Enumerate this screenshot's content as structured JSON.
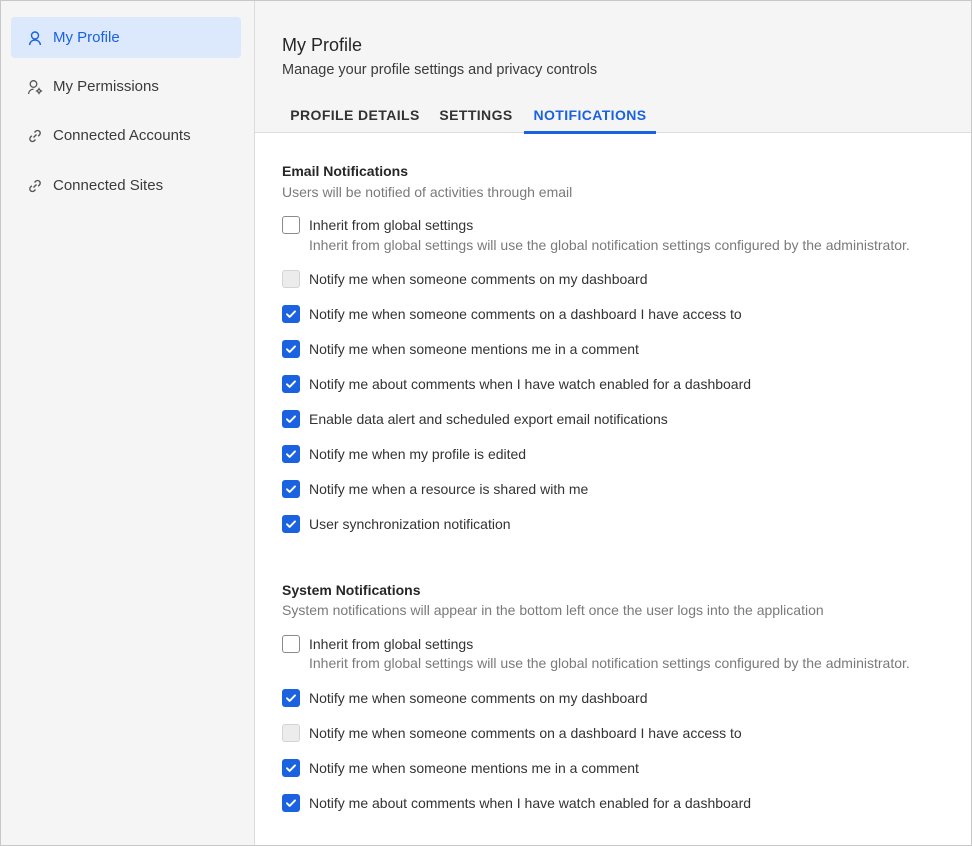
{
  "sidebar": {
    "items": [
      {
        "label": "My Profile",
        "icon": "user-icon",
        "active": true
      },
      {
        "label": "My Permissions",
        "icon": "user-gear-icon",
        "active": false
      },
      {
        "label": "Connected Accounts",
        "icon": "link-icon",
        "active": false
      },
      {
        "label": "Connected Sites",
        "icon": "link-icon",
        "active": false
      }
    ]
  },
  "header": {
    "title": "My Profile",
    "subtitle": "Manage your profile settings and privacy controls",
    "tabs": [
      {
        "label": "PROFILE DETAILS",
        "active": false
      },
      {
        "label": "SETTINGS",
        "active": false
      },
      {
        "label": "NOTIFICATIONS",
        "active": true
      }
    ]
  },
  "colors": {
    "accent": "#1a62e0",
    "active_bg": "#dce8fb"
  },
  "email": {
    "title": "Email Notifications",
    "description": "Users will be notified of activities through email",
    "options": [
      {
        "label": "Inherit from global settings",
        "help": "Inherit from global settings will use the global notification settings configured by the administrator.",
        "state": "unchecked"
      },
      {
        "label": "Notify me when someone comments on my dashboard",
        "state": "disabled"
      },
      {
        "label": "Notify me when someone comments on a dashboard I have access to",
        "state": "checked"
      },
      {
        "label": "Notify me when someone mentions me in a comment",
        "state": "checked"
      },
      {
        "label": "Notify me about comments when I have watch enabled for a dashboard",
        "state": "checked"
      },
      {
        "label": "Enable data alert and scheduled export email notifications",
        "state": "checked"
      },
      {
        "label": "Notify me when my profile is edited",
        "state": "checked"
      },
      {
        "label": "Notify me when a resource is shared with me",
        "state": "checked"
      },
      {
        "label": "User synchronization notification",
        "state": "checked"
      }
    ]
  },
  "system": {
    "title": "System Notifications",
    "description": "System notifications will appear in the bottom left once the user logs into the application",
    "options": [
      {
        "label": "Inherit from global settings",
        "help": "Inherit from global settings will use the global notification settings configured by the administrator.",
        "state": "unchecked"
      },
      {
        "label": "Notify me when someone comments on my dashboard",
        "state": "checked"
      },
      {
        "label": "Notify me when someone comments on a dashboard I have access to",
        "state": "disabled"
      },
      {
        "label": "Notify me when someone mentions me in a comment",
        "state": "checked"
      },
      {
        "label": "Notify me about comments when I have watch enabled for a dashboard",
        "state": "checked"
      }
    ]
  }
}
